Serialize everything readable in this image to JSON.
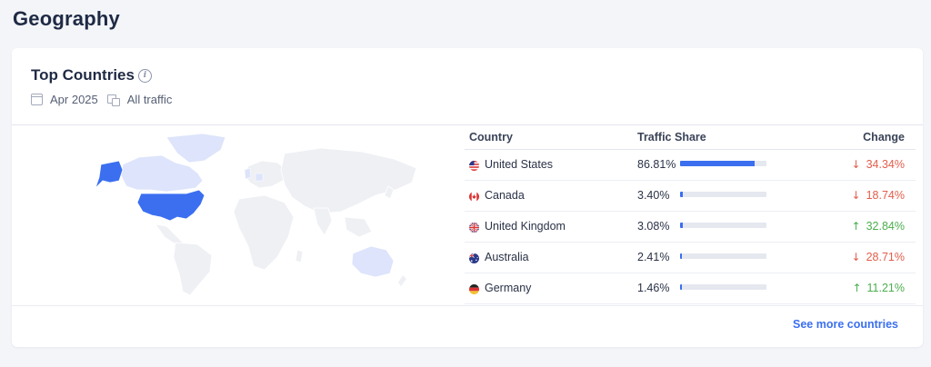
{
  "page": {
    "title": "Geography"
  },
  "card": {
    "title": "Top Countries",
    "date": "Apr 2025",
    "traffic": "All traffic",
    "see_more": "See more countries"
  },
  "icons": {
    "info": "info-icon",
    "date": "calendar-icon",
    "traffic": "traffic-source-icon"
  },
  "colors": {
    "accent": "#3b6ff0",
    "down": "#e35d4b",
    "up": "#4cae4f",
    "map_highlight": "#3b6ff0",
    "map_light": "#dde4fb"
  },
  "table": {
    "headers": {
      "country": "Country",
      "share": "Traffic Share",
      "change": "Change"
    },
    "rows": [
      {
        "country": "United States",
        "flag": "us-flag-icon",
        "share": "86.81%",
        "share_value": 86.81,
        "change": "34.34%",
        "direction": "down"
      },
      {
        "country": "Canada",
        "flag": "canada-flag-icon",
        "share": "3.40%",
        "share_value": 3.4,
        "change": "18.74%",
        "direction": "down"
      },
      {
        "country": "United Kingdom",
        "flag": "uk-flag-icon",
        "share": "3.08%",
        "share_value": 3.08,
        "change": "32.84%",
        "direction": "up"
      },
      {
        "country": "Australia",
        "flag": "australia-flag-icon",
        "share": "2.41%",
        "share_value": 2.41,
        "change": "28.71%",
        "direction": "down"
      },
      {
        "country": "Germany",
        "flag": "germany-flag-icon",
        "share": "1.46%",
        "share_value": 1.46,
        "change": "11.21%",
        "direction": "up"
      }
    ]
  }
}
